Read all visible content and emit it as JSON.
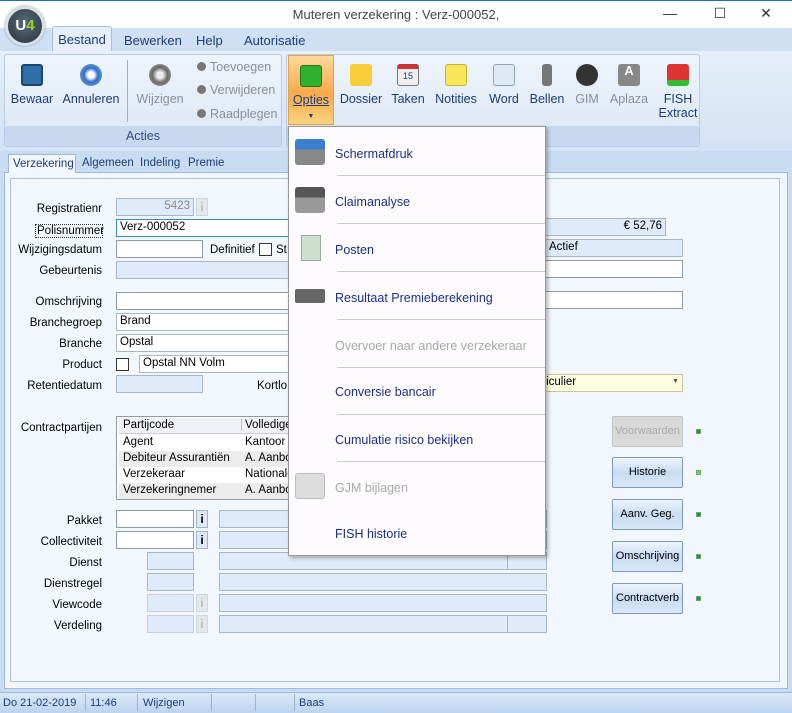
{
  "window": {
    "title": "Muteren verzekering : Verz-000052,",
    "minimize": "—",
    "maximize": "☐",
    "close": "✕",
    "logo": "U4"
  },
  "menubar": [
    "Bestand",
    "Bewerken",
    "Help",
    "Autorisatie"
  ],
  "ribbon": {
    "acties": {
      "label": "Acties",
      "bewaar": "Bewaar",
      "annuleren": "Annuleren",
      "wijzigen": "Wijzigen",
      "toevoegen": "Toevoegen",
      "verwijderen": "Verwijderen",
      "raadplegen": "Raadplegen"
    },
    "opties": "Opties",
    "dossier": "Dossier",
    "taken": "Taken",
    "notities": "Notities",
    "word": "Word",
    "bellen": "Bellen",
    "gim": "GIM",
    "aplaza": "Aplaza",
    "fish1": "FISH",
    "fish2": "Extract",
    "calendar_day": "15"
  },
  "tabs": [
    "Verzekering",
    "Algemeen",
    "Indeling",
    "Premie"
  ],
  "form": {
    "registratienr": {
      "label": "Registratienr",
      "value": "5423"
    },
    "polisnummer": {
      "label": "Polisnummer",
      "value": "Verz-000052"
    },
    "wijzigingsdatum": {
      "label": "Wijzigingsdatum",
      "value": ""
    },
    "definitief": "Definitief",
    "st": "St",
    "gebeurtenis": "Gebeurtenis",
    "omschrijving": "Omschrijving",
    "branchegroep": {
      "label": "Branchegroep",
      "value": "Brand"
    },
    "branche": {
      "label": "Branche",
      "value": "Opstal"
    },
    "product": {
      "label": "Product",
      "value": "Opstal NN Volm"
    },
    "retentiedatum": "Retentiedatum",
    "kortlo": "Kortlo",
    "premie": "€ 52,76",
    "status": "Actief",
    "dropdown": "Particulier",
    "contractpartijen": "Contractpartijen",
    "grid": {
      "headers": [
        "Partijcode",
        "Volledige"
      ],
      "rows": [
        [
          "Agent",
          "Kantoor"
        ],
        [
          "Debiteur Assurantiën",
          "A. Aanbo"
        ],
        [
          "Verzekeraar",
          "Nationale"
        ],
        [
          "Verzekeringnemer",
          "A. Aanbo"
        ]
      ]
    },
    "pakket": "Pakket",
    "collectiviteit": "Collectiviteit",
    "dienst": "Dienst",
    "dienstregel": "Dienstregel",
    "viewcode": "Viewcode",
    "verdeling": "Verdeling",
    "info": "i"
  },
  "side_buttons": [
    "Voorwaarden",
    "Historie",
    "Aanv. Geg.",
    "Omschrijving",
    "Contractverb"
  ],
  "statusbar": {
    "date": "Do 21-02-2019",
    "time": "11:46",
    "mode": "Wijzigen",
    "user": "Baas"
  },
  "opties_menu": [
    {
      "label": "Schermafdruk",
      "enabled": true
    },
    {
      "label": "Claimanalyse",
      "enabled": true
    },
    {
      "label": "Posten",
      "enabled": true
    },
    {
      "label": "Resultaat Premieberekening",
      "enabled": true
    },
    {
      "label": "Overvoer naar andere verzekeraar",
      "enabled": false
    },
    {
      "label": "Conversie bancair",
      "enabled": true
    },
    {
      "label": "Cumulatie risico bekijken",
      "enabled": true
    },
    {
      "label": "GJM bijlagen",
      "enabled": false
    },
    {
      "label": "FISH historie",
      "enabled": true
    }
  ]
}
